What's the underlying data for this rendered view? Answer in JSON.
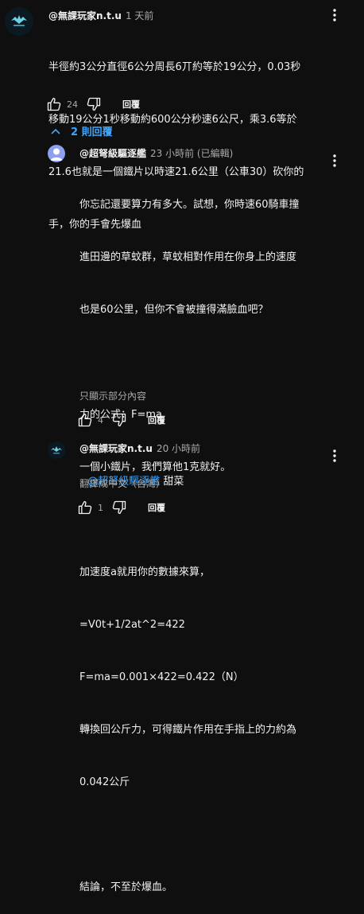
{
  "comment": {
    "author": "@無課玩家n.t.u",
    "time": "1 天前",
    "lines": [
      "半徑約3公分直徑6公分周長6丌約等於19公分，0.03秒",
      "移動19公分1秒移動約600公分秒速6公尺，乘3.6等於",
      "21.6也就是一個鐵片以時速21.6公里（公車30）砍你的",
      "手，你的手會先爆血"
    ],
    "likes": "24",
    "reply_label": "回覆"
  },
  "replies_toggle": {
    "label": "2 則回覆"
  },
  "reply1": {
    "author": "@超弩級驅逐艦",
    "time": "23 小時前 (已編輯)",
    "lines": [
      "你忘記還要算力有多大。試想，你時速60騎車撞",
      "進田邊的草蚊群，草蚊相對作用在你身上的速度",
      "也是60公里，但你不會被撞得滿臉血吧？",
      "",
      "力的公式：F=ma",
      "一個小鐵片，我們算他1克就好。",
      "",
      "加速度a就用你的數據來算，",
      "=V0t+1/2at^2=422",
      "F=ma=0.001×422=0.422（N）",
      "轉換回公斤力，可得鐵片作用在手指上的力約為",
      "0.042公斤",
      "",
      "結論，不至於爆血。"
    ],
    "read_more": "只顯示部分內容",
    "likes": "4",
    "reply_label": "回覆"
  },
  "reply2": {
    "author": "@無課玩家n.t.u",
    "time": "20 小時前",
    "mention": "@超弩級驅逐艦",
    "text": "甜菜",
    "translate": "翻譯成中文（台灣）",
    "likes": "1",
    "reply_label": "回覆"
  }
}
